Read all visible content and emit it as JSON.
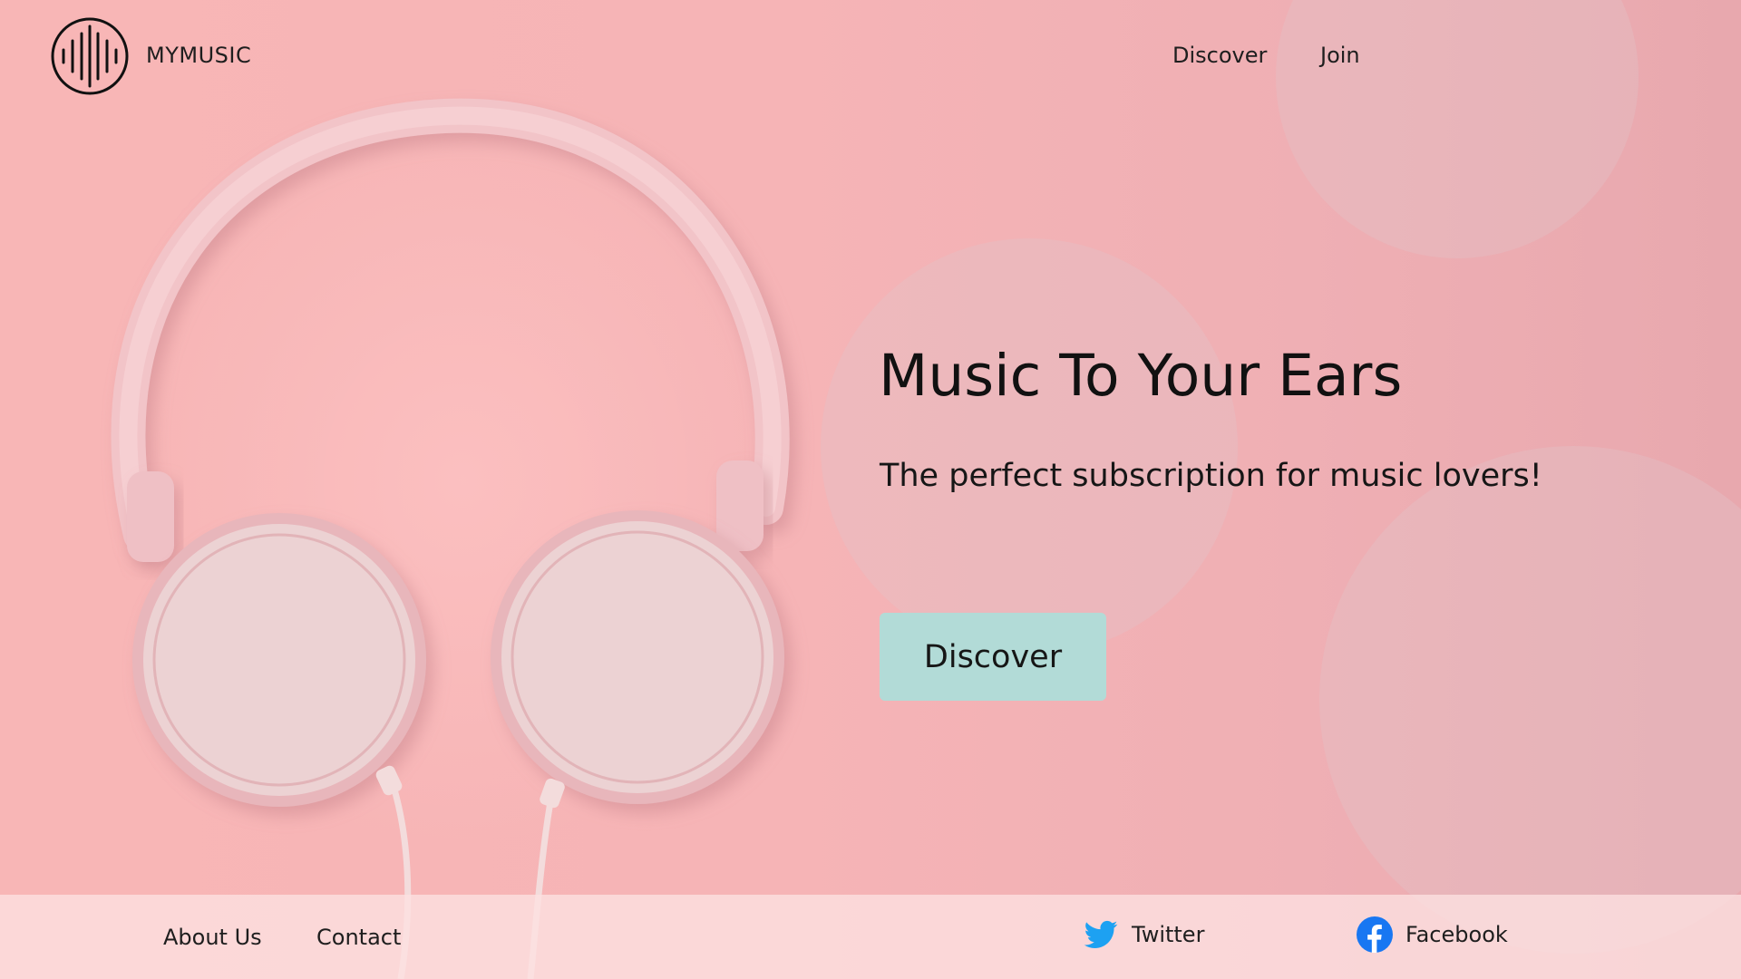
{
  "header": {
    "brand": "MYMUSIC",
    "logo_icon": "sound-wave-icon",
    "nav": [
      {
        "label": "Discover"
      },
      {
        "label": "Join"
      }
    ]
  },
  "hero": {
    "title": "Music To Your Ears",
    "subtitle": "The perfect subscription for music lovers!",
    "cta_label": "Discover",
    "cta_color": "#b2dbd7",
    "image": "pink-headphones"
  },
  "footer": {
    "links": [
      {
        "label": "About Us"
      },
      {
        "label": "Contact"
      }
    ],
    "social": [
      {
        "label": "Twitter",
        "icon": "twitter-icon",
        "color": "#1da1f2"
      },
      {
        "label": "Facebook",
        "icon": "facebook-icon",
        "color": "#1877f2"
      }
    ]
  },
  "theme": {
    "background": "#f6b4b6",
    "text": "#161616"
  }
}
